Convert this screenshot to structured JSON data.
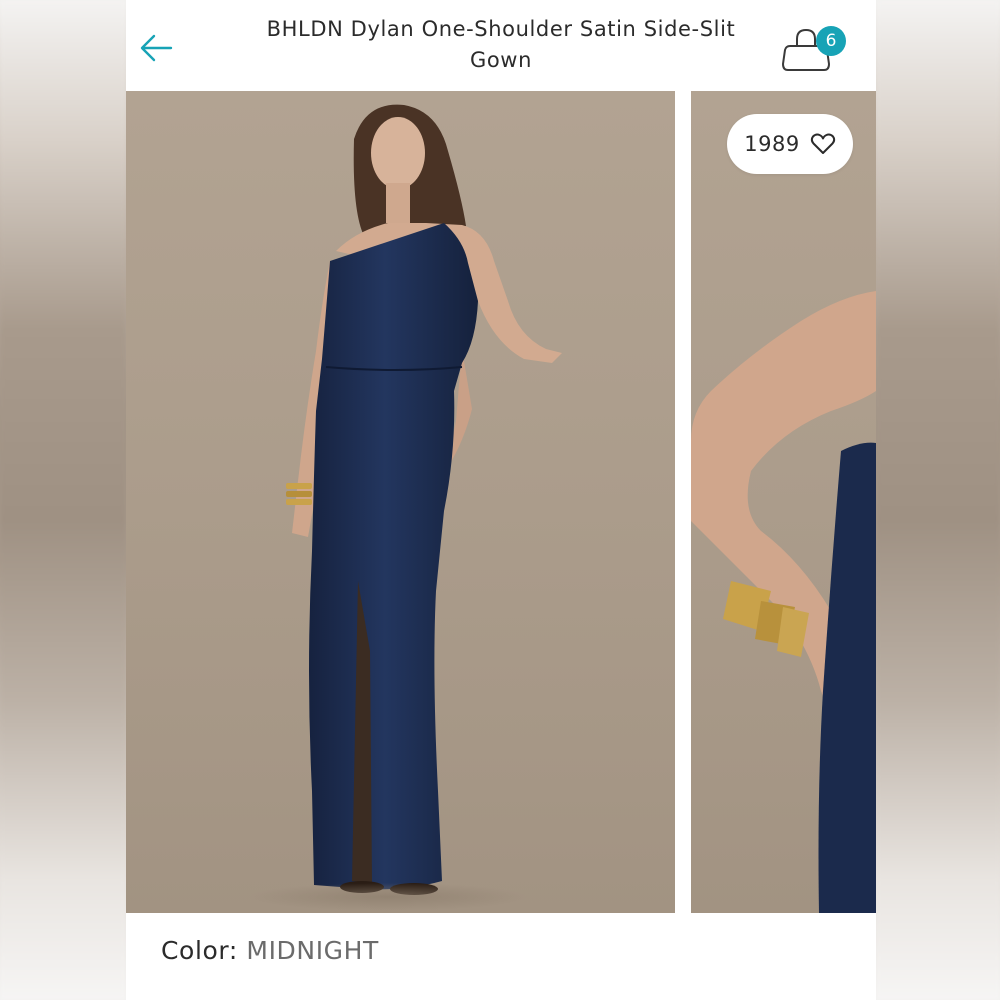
{
  "header": {
    "title": "BHLDN Dylan One-Shoulder Satin Side-Slit Gown",
    "cart_count": "6"
  },
  "gallery": {
    "likes": "1989",
    "images": [
      {
        "alt": "Model wearing navy one-shoulder satin gown with side slit"
      },
      {
        "alt": "Close-up of shoulder and gold cuff bracelets"
      }
    ]
  },
  "product": {
    "color_label": "Color:",
    "color_value": "MIDNIGHT"
  },
  "icons": {
    "back": "arrow-left-icon",
    "bag": "shopping-bag-icon",
    "like": "heart-icon"
  },
  "colors": {
    "accent": "#17a3b6",
    "gown": "#1b2b4f",
    "backdrop": "#ad9e8d",
    "text": "#2b2b2b"
  }
}
